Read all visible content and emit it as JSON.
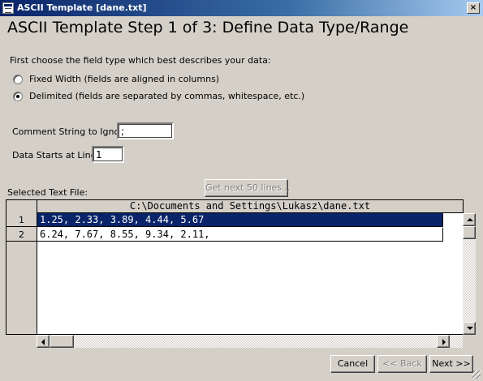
{
  "window": {
    "title": "ASCII Template [dane.txt]",
    "close_glyph": "×"
  },
  "heading": "ASCII Template Step 1 of 3: Define Data Type/Range",
  "field_type": {
    "prompt": "First choose the field type which best describes your data:",
    "options": [
      {
        "label": "Fixed Width  (fields are aligned in columns)",
        "selected": false
      },
      {
        "label": "Delimited  (fields are separated by commas, whitespace, etc.)",
        "selected": true
      }
    ]
  },
  "comment_string": {
    "label": "Comment String to Ignore:",
    "value": ";"
  },
  "data_start": {
    "label": "Data Starts at Line:",
    "value": "1"
  },
  "selected_file_label": "Selected Text File:",
  "get_next_button": "Get next 50 lines...",
  "file_view": {
    "path": "C:\\Documents and Settings\\Lukasz\\dane.txt",
    "rows": [
      {
        "num": "1",
        "text": "1.25, 2.33, 3.89, 4.44, 5.67",
        "selected": true
      },
      {
        "num": "2",
        "text": "6.24, 7.67, 8.55, 9.34, 2.11,",
        "selected": false
      }
    ]
  },
  "buttons": {
    "cancel": "Cancel",
    "back": "<< Back",
    "next": "Next >>"
  }
}
